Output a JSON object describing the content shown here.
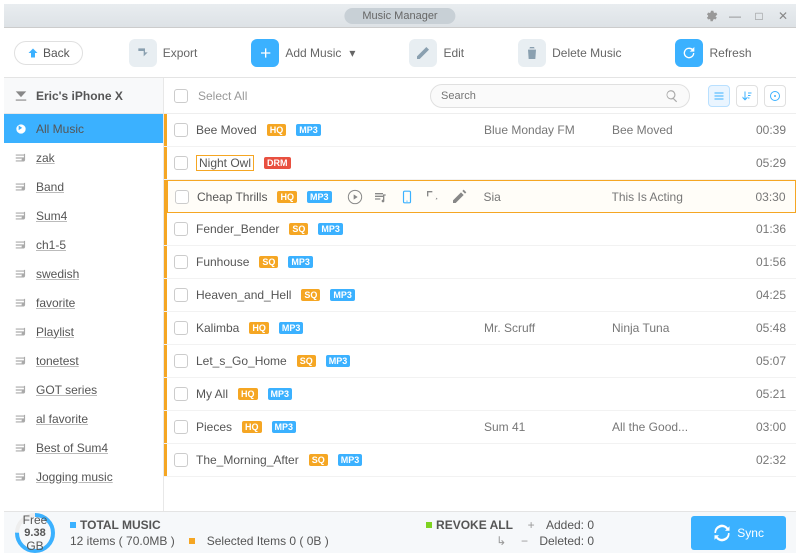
{
  "window": {
    "title": "Music Manager"
  },
  "toolbar": {
    "back": "Back",
    "export": "Export",
    "add_music": "Add Music",
    "edit": "Edit",
    "delete_music": "Delete Music",
    "refresh": "Refresh"
  },
  "sidebar": {
    "device_name": "Eric's iPhone X",
    "items": [
      "All Music",
      "zak",
      "Band",
      "Sum4",
      "ch1-5",
      "swedish",
      "favorite",
      "Playlist",
      "tonetest",
      "GOT series",
      "al favorite",
      "Best of Sum4",
      "Jogging music"
    ]
  },
  "header": {
    "select_all": "Select All",
    "search_placeholder": "Search"
  },
  "tracks": [
    {
      "name": "Bee Moved",
      "q": "HQ",
      "fmt": "MP3",
      "artist": "Blue Monday FM",
      "album": "Bee Moved",
      "dur": "00:39"
    },
    {
      "name": "Night Owl",
      "drm": true,
      "artist": "",
      "album": "",
      "dur": "05:29",
      "boxed": true
    },
    {
      "name": "Cheap Thrills",
      "q": "HQ",
      "fmt": "MP3",
      "artist": "Sia",
      "album": "This Is Acting",
      "dur": "03:30",
      "hl": true
    },
    {
      "name": "Fender_Bender",
      "q": "SQ",
      "fmt": "MP3",
      "artist": "",
      "album": "",
      "dur": "01:36"
    },
    {
      "name": "Funhouse",
      "q": "SQ",
      "fmt": "MP3",
      "artist": "",
      "album": "",
      "dur": "01:56"
    },
    {
      "name": "Heaven_and_Hell",
      "q": "SQ",
      "fmt": "MP3",
      "artist": "",
      "album": "",
      "dur": "04:25"
    },
    {
      "name": "Kalimba",
      "q": "HQ",
      "fmt": "MP3",
      "artist": "Mr. Scruff",
      "album": "Ninja Tuna",
      "dur": "05:48"
    },
    {
      "name": "Let_s_Go_Home",
      "q": "SQ",
      "fmt": "MP3",
      "artist": "",
      "album": "",
      "dur": "05:07"
    },
    {
      "name": "My All",
      "q": "HQ",
      "fmt": "MP3",
      "artist": "",
      "album": "",
      "dur": "05:21"
    },
    {
      "name": "Pieces",
      "q": "HQ",
      "fmt": "MP3",
      "artist": "Sum 41",
      "album": "All the Good...",
      "dur": "03:00"
    },
    {
      "name": "The_Morning_After",
      "q": "SQ",
      "fmt": "MP3",
      "artist": "",
      "album": "",
      "dur": "02:32"
    }
  ],
  "footer": {
    "gauge_label": "Free",
    "gauge_value": "9.38",
    "gauge_unit": "GB",
    "total_label": "TOTAL MUSIC",
    "total_detail": "12 items ( 70.0MB )",
    "selected": "Selected Items 0 ( 0B )",
    "revoke": "REVOKE ALL",
    "added": "Added: 0",
    "deleted": "Deleted: 0",
    "sync": "Sync"
  }
}
